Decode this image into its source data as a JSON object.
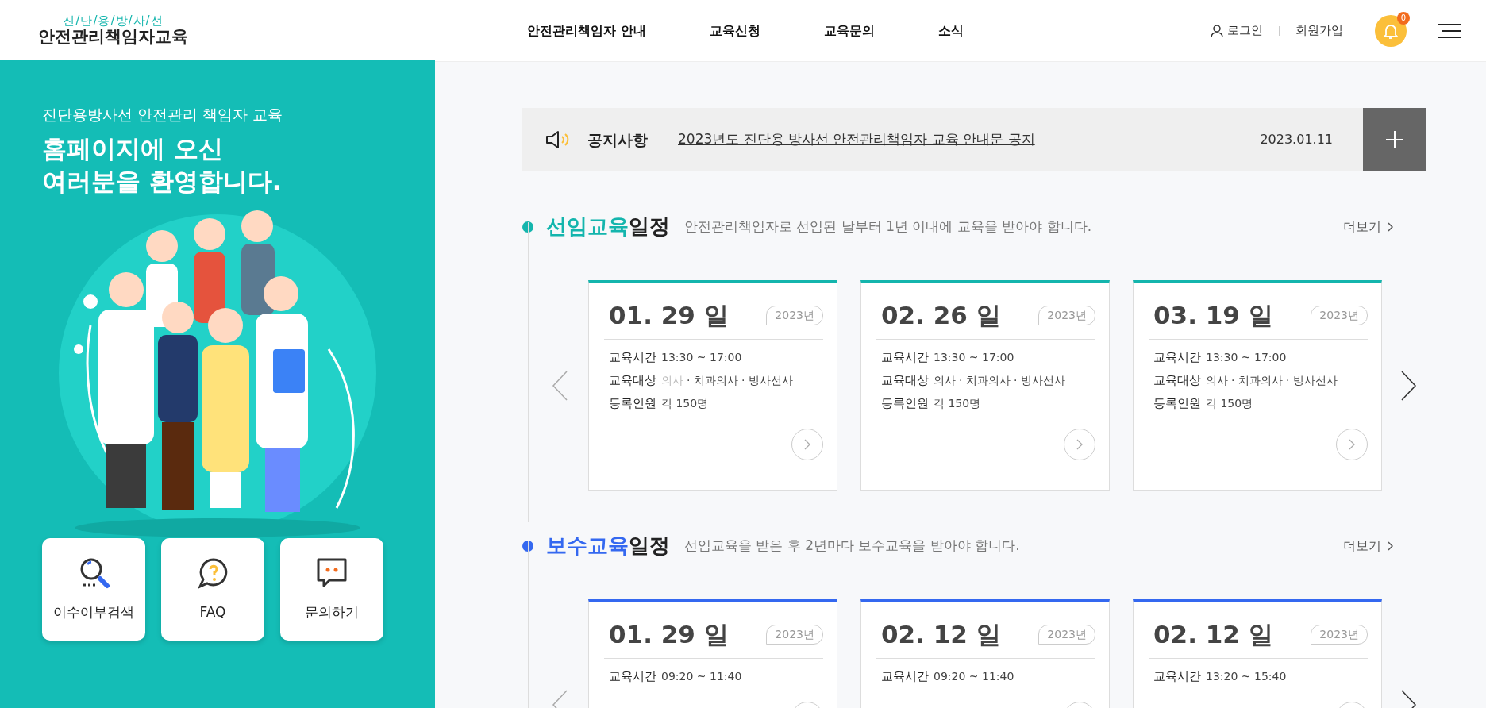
{
  "header": {
    "logo_top": "진/단/용/방/사/선",
    "logo_main": "안전관리책임자교육",
    "nav": [
      {
        "label": "안전관리책임자 안내"
      },
      {
        "label": "교육신청"
      },
      {
        "label": "교육문의"
      },
      {
        "label": "소식"
      }
    ],
    "login": "로그인",
    "signup": "회원가입",
    "notification_count": "0"
  },
  "hero": {
    "subtitle": "진단용방사선 안전관리 책임자 교육",
    "title_lines": [
      "홈페이지에 오신",
      "여러분을 환영합니다."
    ]
  },
  "quick_links": [
    {
      "kind": "search",
      "label": "이수여부검색"
    },
    {
      "kind": "faq",
      "label": "FAQ"
    },
    {
      "kind": "inquiry",
      "label": "문의하기"
    }
  ],
  "notice": {
    "heading": "공지사항",
    "text": "2023년도 진단용 방사선 안전관리책임자 교육 안내문 공지",
    "date": "2023.01.11"
  },
  "sections": [
    {
      "title_accent": "선임교육",
      "title_rest": "일정",
      "color": "#14b5ad",
      "description": "안전관리책임자로 선임된 날부터 1년 이내에 교육을 받아야 합니다.",
      "more": "더보기",
      "cards": [
        {
          "date": "01. 29",
          "day": "일",
          "year": "2023년",
          "rows": [
            {
              "kind": "text",
              "label": "교육시간",
              "value": "13:30 ~ 17:00"
            },
            {
              "kind": "targets",
              "label": "교육대상",
              "targets": [
                {
                  "text": "의사",
                  "disabled": true
                },
                {
                  "text": "· 치과의사",
                  "disabled": false
                },
                {
                  "text": "· 방사선사",
                  "disabled": false
                }
              ]
            },
            {
              "kind": "text",
              "label": "등록인원",
              "value": "각 150명"
            }
          ]
        },
        {
          "date": "02. 26",
          "day": "일",
          "year": "2023년",
          "rows": [
            {
              "kind": "text",
              "label": "교육시간",
              "value": "13:30 ~ 17:00"
            },
            {
              "kind": "targets",
              "label": "교육대상",
              "targets": [
                {
                  "text": "의사",
                  "disabled": false
                },
                {
                  "text": "· 치과의사",
                  "disabled": false
                },
                {
                  "text": "· 방사선사",
                  "disabled": false
                }
              ]
            },
            {
              "kind": "text",
              "label": "등록인원",
              "value": "각 150명"
            }
          ]
        },
        {
          "date": "03. 19",
          "day": "일",
          "year": "2023년",
          "rows": [
            {
              "kind": "text",
              "label": "교육시간",
              "value": "13:30 ~ 17:00"
            },
            {
              "kind": "targets",
              "label": "교육대상",
              "targets": [
                {
                  "text": "의사",
                  "disabled": false
                },
                {
                  "text": "· 치과의사",
                  "disabled": false
                },
                {
                  "text": "· 방사선사",
                  "disabled": false
                }
              ]
            },
            {
              "kind": "text",
              "label": "등록인원",
              "value": "각 150명"
            }
          ]
        }
      ]
    },
    {
      "title_accent": "보수교육",
      "title_rest": "일정",
      "color": "#3468f0",
      "description": "선임교육을 받은 후 2년마다 보수교육을 받아야 합니다.",
      "more": "더보기",
      "cards": [
        {
          "date": "01. 29",
          "day": "일",
          "year": "2023년",
          "rows": [
            {
              "kind": "text",
              "label": "교육시간",
              "value": "09:20 ~ 11:40"
            }
          ]
        },
        {
          "date": "02. 12",
          "day": "일",
          "year": "2023년",
          "rows": [
            {
              "kind": "text",
              "label": "교육시간",
              "value": "09:20 ~ 11:40"
            }
          ]
        },
        {
          "date": "02. 12",
          "day": "일",
          "year": "2023년",
          "rows": [
            {
              "kind": "text",
              "label": "교육시간",
              "value": "13:20 ~ 15:40"
            }
          ]
        }
      ]
    }
  ]
}
